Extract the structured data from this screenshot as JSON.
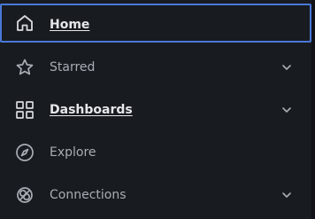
{
  "nav": {
    "items": [
      {
        "label": "Home",
        "icon": "home-icon",
        "active": true,
        "expandable": false
      },
      {
        "label": "Starred",
        "icon": "star-icon",
        "active": false,
        "expandable": true
      },
      {
        "label": "Dashboards",
        "icon": "dashboards-grid-icon",
        "active": false,
        "expandable": true
      },
      {
        "label": "Explore",
        "icon": "compass-icon",
        "active": false,
        "expandable": false
      },
      {
        "label": "Connections",
        "icon": "connections-icon",
        "active": false,
        "expandable": true
      }
    ]
  },
  "colors": {
    "background": "#181b1f",
    "active_border": "#4a78d8",
    "text": "#a9adb5",
    "text_active": "#e6e7ea"
  }
}
